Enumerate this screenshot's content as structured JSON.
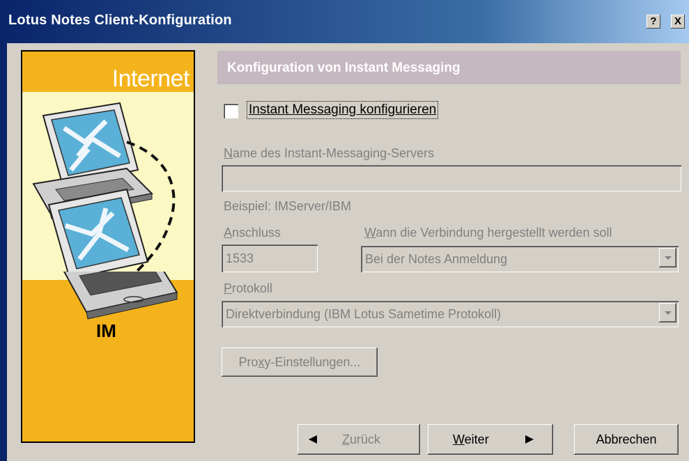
{
  "window": {
    "title": "Lotus Notes Client-Konfiguration",
    "help_button": "?",
    "close_button": "X"
  },
  "illustration": {
    "top_text": "Internet",
    "bottom_text": "IM",
    "colors": {
      "band": "#f5b31b",
      "center": "#fbf8c4"
    }
  },
  "section": {
    "header": "Konfiguration von Instant Messaging"
  },
  "configure_checkbox": {
    "label": "Instant Messaging konfigurieren",
    "checked": false
  },
  "server": {
    "label_underlined": "N",
    "label_rest": "ame des Instant-Messaging-Servers",
    "value": "",
    "example": "Beispiel: IMServer/IBM"
  },
  "port": {
    "label_underlined": "A",
    "label_rest": "nschluss",
    "value": "1533"
  },
  "connect_when": {
    "label_underlined": "W",
    "label_rest": "ann die Verbindung hergestellt werden soll",
    "value": "Bei der Notes Anmeldung"
  },
  "protocol": {
    "label_underlined": "P",
    "label_rest": "rotokoll",
    "value": "Direktverbindung (IBM Lotus Sametime Protokoll)"
  },
  "proxy_button": {
    "label_pre": "Pro",
    "label_underlined": "x",
    "label_post": "y-Einstellungen..."
  },
  "nav": {
    "back_underlined": "Z",
    "back_rest": "urück",
    "next_underlined": "W",
    "next_rest": "eiter",
    "cancel": "Abbrechen"
  },
  "colors": {
    "titlebar": "#0a246a",
    "dialog_bg": "#d4d0c8",
    "section_header_bg": "#c6b8c1",
    "disabled_text": "#808080"
  }
}
